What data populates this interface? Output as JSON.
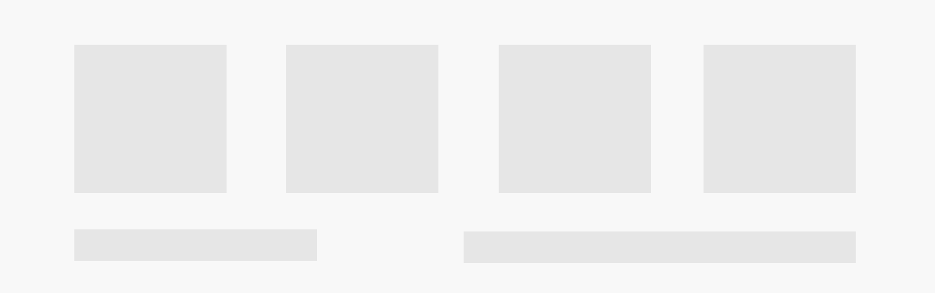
{
  "page": {
    "background_color": "#f8f8f8",
    "placeholder_color": "#e6e6e6"
  },
  "tiles": [
    {
      "kind": "image-placeholder"
    },
    {
      "kind": "image-placeholder"
    },
    {
      "kind": "image-placeholder"
    },
    {
      "kind": "image-placeholder"
    }
  ],
  "bars": [
    {
      "kind": "text-placeholder"
    },
    {
      "kind": "text-placeholder"
    }
  ]
}
